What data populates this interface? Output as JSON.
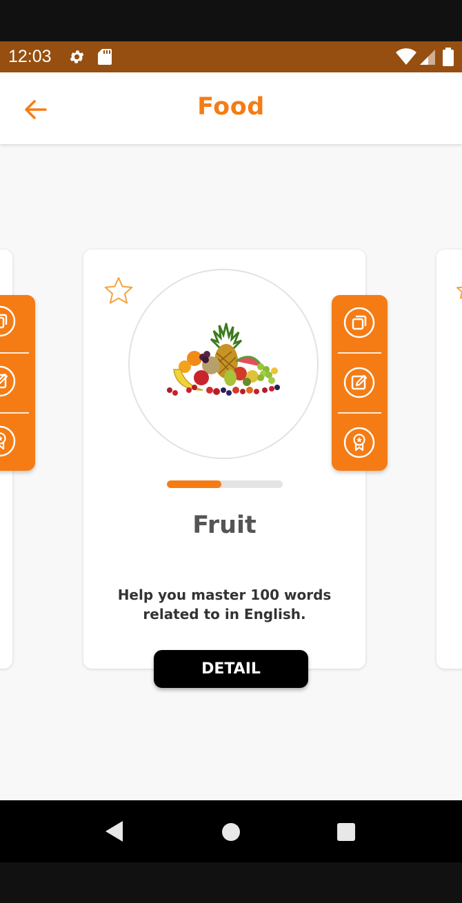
{
  "status_bar": {
    "time": "12:03",
    "icons": [
      "gear-icon",
      "sd-card-icon",
      "wifi-icon",
      "signal-icon",
      "battery-icon"
    ],
    "background": "#964f10"
  },
  "header": {
    "title": "Food",
    "back_icon": "arrow-left-icon",
    "accent_color": "#f57c14"
  },
  "card": {
    "title": "Fruit",
    "description": "Help you master 100 words related to in English.",
    "progress": 0.47,
    "favorite_icon": "star-outline-icon",
    "image": "fruit-pile-image",
    "detail_button_label": "DETAIL"
  },
  "side_panel": {
    "actions": [
      "flashcards-icon",
      "edit-icon",
      "award-icon"
    ]
  },
  "nav_bar": {
    "buttons": [
      "back-triangle-icon",
      "home-circle-icon",
      "recents-square-icon"
    ]
  }
}
